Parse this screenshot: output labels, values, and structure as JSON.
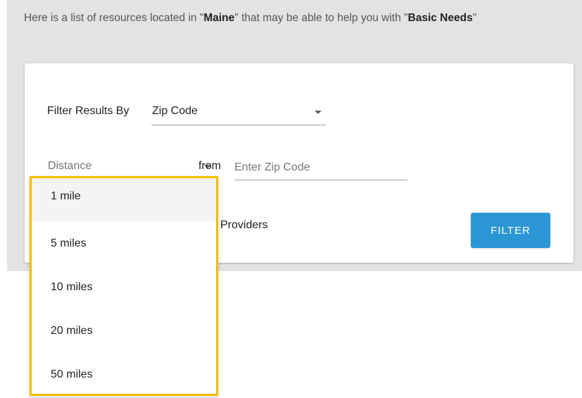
{
  "intro": {
    "prefix": "Here is a list of resources located in \"",
    "location": "Maine",
    "middle": "\" that may be able to help you with \"",
    "category": "Basic Needs",
    "suffix": "\""
  },
  "filter": {
    "label": "Filter Results By",
    "selected": "Zip Code",
    "distance_placeholder": "Distance",
    "from_label": "from",
    "zip_placeholder": "Enter Zip Code",
    "providers_label": "Providers",
    "button_label": "FILTER"
  },
  "distance_options": [
    "1 mile",
    "5 miles",
    "10 miles",
    "20 miles",
    "50 miles"
  ],
  "colors": {
    "accent": "#2a97d4",
    "highlight_border": "#f5bd00",
    "band": "#e3e3e3"
  },
  "icons": {
    "select_caret": "caret-down-icon"
  }
}
